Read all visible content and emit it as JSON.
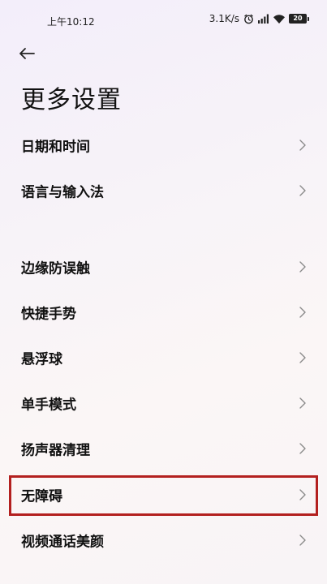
{
  "status_bar": {
    "time": "上午10:12",
    "network_speed": "3.1K/s",
    "battery_level": "20",
    "icons": [
      "alarm-icon",
      "signal-icon",
      "wifi-icon",
      "battery-icon"
    ]
  },
  "header": {
    "back_icon": "arrow-left-icon",
    "title": "更多设置"
  },
  "settings": {
    "items": [
      {
        "label": "日期和时间"
      },
      {
        "label": "语言与输入法"
      },
      {
        "label": "边缘防误触"
      },
      {
        "label": "快捷手势"
      },
      {
        "label": "悬浮球"
      },
      {
        "label": "单手模式"
      },
      {
        "label": "扬声器清理"
      },
      {
        "label": "无障碍"
      },
      {
        "label": "视频通话美颜"
      }
    ]
  },
  "colors": {
    "highlight_border": "#b3201f",
    "text": "#111111",
    "chevron": "#8a8a8a"
  }
}
